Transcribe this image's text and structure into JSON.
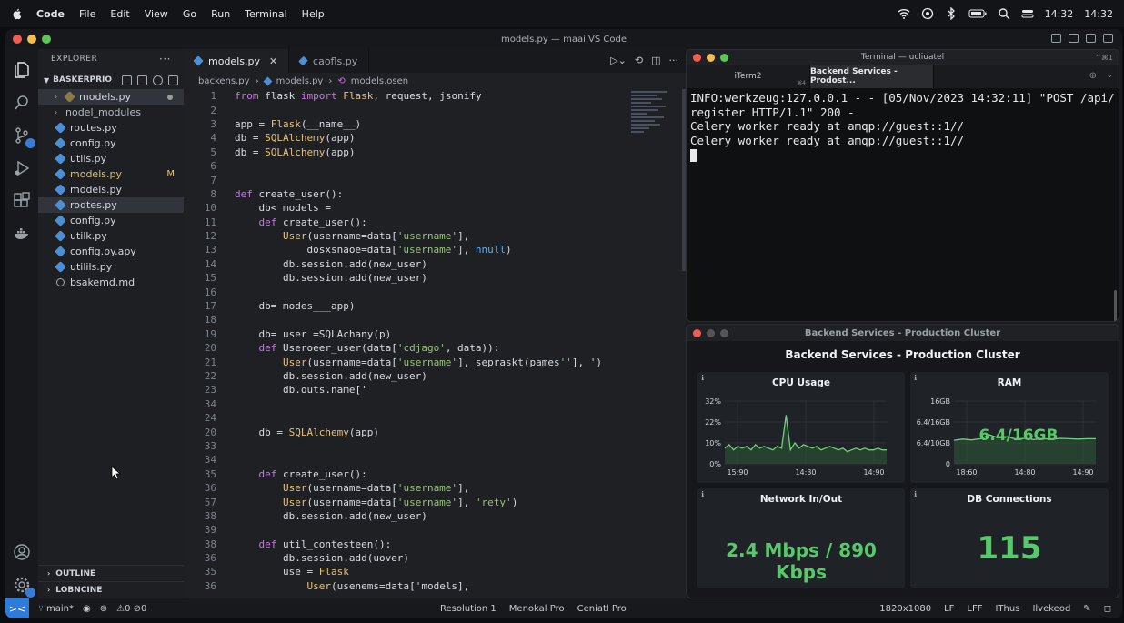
{
  "menubar": {
    "app": "Code",
    "items": [
      "File",
      "Edit",
      "View",
      "Go",
      "Run",
      "Terminal",
      "Help"
    ],
    "clock_a": "14:32",
    "clock_b": "14:32"
  },
  "window": {
    "title": "models.py — maai VS Code"
  },
  "sidebar": {
    "header": "EXPLORER",
    "more": "···",
    "project": "BASKERPRIO",
    "files": [
      {
        "name": "models.py",
        "indent": true,
        "chevron": true,
        "dot": true,
        "selected": true
      },
      {
        "name": "nodel_modules",
        "indent": true,
        "chevron": true
      },
      {
        "name": "routes.py"
      },
      {
        "name": "config.py"
      },
      {
        "name": "utils.py"
      },
      {
        "name": "models.py",
        "flag": "M",
        "modified": true
      },
      {
        "name": "models.py"
      },
      {
        "name": "roqtes.py",
        "selected": true
      },
      {
        "name": "config.py"
      },
      {
        "name": "utilk.py"
      },
      {
        "name": "config.py.apy"
      },
      {
        "name": "utilils.py"
      },
      {
        "name": "bsakemd.md",
        "info": true
      }
    ],
    "outline": "OUTLINE",
    "timeline": "LOBNCINE"
  },
  "tabs": [
    {
      "label": "models.py",
      "close": "✕"
    },
    {
      "label": "caofls.py"
    }
  ],
  "breadcrumb": [
    "backens.py",
    "models.py",
    "models.osen"
  ],
  "code": [
    {
      "n": "1",
      "t": "from flask import Flask, request, jsonify"
    },
    {
      "n": "2",
      "t": ""
    },
    {
      "n": "3",
      "t": "app = Flask(__name__)"
    },
    {
      "n": "4",
      "t": "db = SQLAlchemy(app)"
    },
    {
      "n": "5",
      "t": "db = SQLAlchemy(app)"
    },
    {
      "n": "6",
      "t": ""
    },
    {
      "n": "7",
      "t": ""
    },
    {
      "n": "8",
      "t": "def create_user():"
    },
    {
      "n": "10",
      "t": "    db< models ="
    },
    {
      "n": "11",
      "t": "    def create_user():"
    },
    {
      "n": "12",
      "t": "        User(username=data['username'],"
    },
    {
      "n": "13",
      "t": "            dosxsnaoe=data['username'], nnull)"
    },
    {
      "n": "14",
      "t": "        db.session.add(new_user)"
    },
    {
      "n": "15",
      "t": "        db.session.add(new_user)"
    },
    {
      "n": "16",
      "t": ""
    },
    {
      "n": "17",
      "t": "    db= modes___app)"
    },
    {
      "n": "18",
      "t": ""
    },
    {
      "n": "19",
      "t": "    db= user =SQLAchany(p)"
    },
    {
      "n": "20",
      "t": "    def Useroeer_user(data['cdjago', data)):"
    },
    {
      "n": "21",
      "t": "        User(username=data['username'], sepraskt(pames''], ')"
    },
    {
      "n": "22",
      "t": "        db.session.add(new_user)"
    },
    {
      "n": "23",
      "t": "        db.outs.name['"
    },
    {
      "n": "34",
      "t": ""
    },
    {
      "n": "24",
      "t": ""
    },
    {
      "n": "20",
      "t": "    db = SQLAlchemy(app)"
    },
    {
      "n": "33",
      "t": ""
    },
    {
      "n": "34",
      "t": ""
    },
    {
      "n": "35",
      "t": "    def create_user():"
    },
    {
      "n": "36",
      "t": "        User(username=data['username'],"
    },
    {
      "n": "57",
      "t": "        User(username=data['username'], 'rety')"
    },
    {
      "n": "38",
      "t": "        db.session.add(new_user)"
    },
    {
      "n": "39",
      "t": ""
    },
    {
      "n": "38",
      "t": "    def util_contesteen():"
    },
    {
      "n": "36",
      "t": "        db.session.add(uover)"
    },
    {
      "n": "35",
      "t": "        use = Flask"
    },
    {
      "n": "36",
      "t": "            User(usenems=data['models],"
    }
  ],
  "terminal": {
    "title": "Terminal — ucliuatel",
    "shortcut": "⌃⌘1",
    "tabs": [
      {
        "label": "iTerm2",
        "sub": "⌘4"
      },
      {
        "label": "Backend Services - Prodost..."
      }
    ],
    "plus": "⊕",
    "chevron": "⌄",
    "lines": [
      "INFO:werkzeug:127.0.0.1 - - [05/Nov/2023 14:32:11] \"POST /api/register HTTP/1.1\" 200 -",
      "Celery worker ready at amqp://guest::1//",
      "Celery worker ready at amqp://guest::1//"
    ]
  },
  "dashboard": {
    "window_title": "Backend Services - Production Cluster",
    "heading": "Backend Services - Production Cluster",
    "panels": {
      "cpu": {
        "title": "CPU Usage",
        "corner": "ℹ"
      },
      "ram": {
        "title": "RAM",
        "corner": "ℹ",
        "value": "6.4/16GB"
      },
      "net": {
        "title": "Network In/Out",
        "corner": "ℹ",
        "value": "2.4 Mbps / 890 Kbps"
      },
      "db": {
        "title": "DB Connections",
        "corner": "ℹ",
        "value": "115"
      }
    }
  },
  "chart_data": [
    {
      "type": "line",
      "title": "CPU Usage",
      "yticks": [
        "32%",
        "22%",
        "10%",
        "0%"
      ],
      "xticks": [
        "15:90",
        "14:30",
        "14:90"
      ],
      "color": "#6fd17e",
      "series": [
        {
          "values": [
            9,
            11,
            8,
            10,
            9,
            10,
            8,
            11,
            9,
            10,
            9,
            8,
            10,
            9,
            28,
            8,
            12,
            9,
            11,
            10,
            9,
            10,
            8,
            9,
            10,
            9,
            8,
            9,
            7,
            8,
            9,
            8,
            9,
            8,
            8,
            9,
            8,
            8
          ]
        }
      ],
      "ylim": [
        0,
        36
      ]
    },
    {
      "type": "line",
      "title": "RAM",
      "yticks": [
        "16GB",
        "6.4/16GB",
        "6.4/10GB",
        "0"
      ],
      "xticks": [
        "18:60",
        "14:80",
        "14:90"
      ],
      "color": "#6fd17e",
      "series": [
        {
          "values": [
            6.0,
            6.3,
            6.1,
            6.4,
            7.4,
            6.6,
            6.9,
            6.3,
            6.5,
            6.2,
            6.4,
            6.3,
            6.5,
            6.4,
            6.3,
            6.4,
            6.4
          ]
        }
      ],
      "ylim": [
        0,
        16
      ]
    }
  ],
  "statusbar": {
    "remote": "><",
    "branch": "main*",
    "problems": "⚠0 ⊘0",
    "mid": [
      "Resolution 1",
      "Menokal Pro",
      "Ceniatl Pro"
    ],
    "right": [
      "1820x1080",
      "LF",
      "LFF",
      "IThus",
      "Ilvekeod"
    ]
  },
  "colors": {
    "accent": "#2f7bd9",
    "chart_line": "#6fd17e",
    "chart_fill": "#2f5a37"
  }
}
